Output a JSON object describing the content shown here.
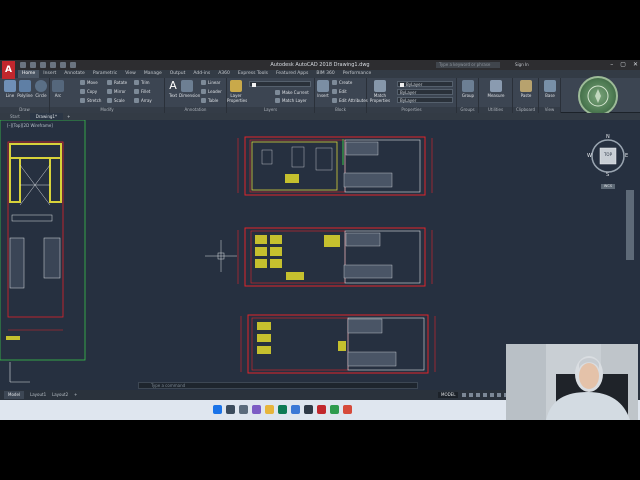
{
  "titlebar": {
    "app_logo": "A",
    "title": "Autodesk AutoCAD 2018   Drawing1.dwg",
    "search_placeholder": "Type a keyword or phrase",
    "user": "Sign In",
    "window_buttons": [
      "–",
      "▢",
      "✕"
    ]
  },
  "ribbon_tabs": [
    "Home",
    "Insert",
    "Annotate",
    "Parametric",
    "View",
    "Manage",
    "Output",
    "Add-ins",
    "A360",
    "Express Tools",
    "Featured Apps",
    "BIM 360",
    "Performance"
  ],
  "ribbon": {
    "draw": {
      "title": "Draw",
      "big_tools": [
        "Line",
        "Polyline",
        "Circle",
        "Arc"
      ]
    },
    "modify": {
      "title": "Modify",
      "tools": [
        "Move",
        "Rotate",
        "Trim",
        "Copy",
        "Mirror",
        "Fillet",
        "Stretch",
        "Scale",
        "Array"
      ]
    },
    "annotation": {
      "title": "Annotation",
      "big_tools": [
        "Text",
        "Dimension"
      ],
      "tools": [
        "Linear",
        "Leader",
        "Table"
      ]
    },
    "layers": {
      "title": "Layers",
      "big_tools": [
        "Layer Properties"
      ],
      "tools": [
        "Make Current",
        "Match Layer"
      ]
    },
    "block": {
      "title": "Block",
      "big_tools": [
        "Insert"
      ],
      "tools": [
        "Create",
        "Edit",
        "Edit Attributes"
      ]
    },
    "properties": {
      "title": "Properties",
      "big_tools": [
        "Match Properties"
      ],
      "fields": [
        "ByLayer",
        "ByLayer",
        "ByLayer"
      ]
    },
    "groups": {
      "title": "Groups",
      "big_tools": [
        "Group"
      ]
    },
    "utilities": {
      "title": "Utilities",
      "big_tools": [
        "Measure"
      ]
    },
    "clipboard": {
      "title": "Clipboard",
      "big_tools": [
        "Paste"
      ]
    },
    "view": {
      "title": "View",
      "big_tools": [
        "Base"
      ]
    }
  },
  "doc_tabs": [
    "Start",
    "Drawing1*",
    "+"
  ],
  "viewport_label": "[–][Top][2D Wireframe]",
  "viewcube": {
    "face": "TOP",
    "north": "N",
    "south": "S",
    "east": "E",
    "west": "W",
    "ucs": "WCS"
  },
  "command_line": "Type a command",
  "layout_tabs": [
    "Model",
    "Layout1",
    "Layout2",
    "+"
  ],
  "status": {
    "model": "MODEL"
  },
  "colors": {
    "canvas": "#263040",
    "plan_red": "#e0242a",
    "wall_yellow": "#d7d23a",
    "green": "#39c24a",
    "white_line": "#d9dde2",
    "ribbon": "#3c4552"
  }
}
